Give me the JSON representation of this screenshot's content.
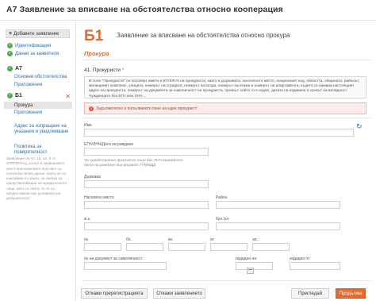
{
  "header": {
    "title": "А7 Заявление за вписване на обстоятелства относно кооперация"
  },
  "sidebar": {
    "add_label": "Добавете заявление",
    "items": [
      {
        "label": "Идентификация"
      },
      {
        "label": "Данни за заявителя"
      },
      {
        "label": "А7"
      },
      {
        "label": "Основни обстоятелства"
      },
      {
        "label": "Приложения"
      },
      {
        "label": "Б1"
      },
      {
        "label": "Прокура"
      },
      {
        "label": "Приложения"
      },
      {
        "label": "Адрес за изпращане на указания и уведомяване"
      },
      {
        "label": "Политика за поверителност"
      }
    ],
    "note": "Заявление по чл. 15, ал. 9 от ЗТРРЮЛНЦ, когато в заявлението или в приложенията към него са посочени лични данни, които не са изисквани по закон, за сметка на представляващия на юридическото лице, като се счита, че те са предоставени при условията на доброволност"
  },
  "main": {
    "code": "Б1",
    "title": "Заявление за вписване на обстоятелства относно прокура",
    "section": "Прокура",
    "field_title": "41. Прокуристи",
    "required_mark": "*",
    "info": "В поле \"Прокуристи\" се посочват името и ЕГН/ЛНЧ на прокуриста, както и държавата, населеното място, пощенският код, областта, общината, районът, жилищният комплекс, улицата, номерът на сградата, номерът на входа, номерът на етажа и номерът на апартамента, където се намира настоящият адрес на прокуриста, номерът на документа за самоличност на прокуриста, органът, който го е издал, датата на издаване и срокът на валидност. Чужденците без ЕГН или ЛНЧ...",
    "error": "Задължително е попълването поне на един прокурист!",
    "fields": {
      "name_label": "Име",
      "egn_label": "ЕГН/ЛНЧ/Дата на раждане",
      "egn_hint": "За чуждестранно физическо лице без ЛНЧ въвеждате дата на раждане във формат ГГММДД",
      "country_label": "Държава",
      "city_label": "Населено място",
      "region_label": "Район",
      "complex_label": "ж.к.",
      "street_label": "бул./ул.",
      "no_label": "№",
      "bl_label": "бл.",
      "entr_label": "вх.",
      "floor_label": "ет.",
      "apt_label": "ап.",
      "id_label": "№ на документ за самоличност",
      "issued_label": "издаден на",
      "issued_by_label": "издаден от"
    }
  },
  "footer": {
    "cancel_reg": "Откажи пререгистрацията",
    "cancel_app": "Откажи заявлението",
    "preview": "Прегледай",
    "continue": "Продължи"
  }
}
